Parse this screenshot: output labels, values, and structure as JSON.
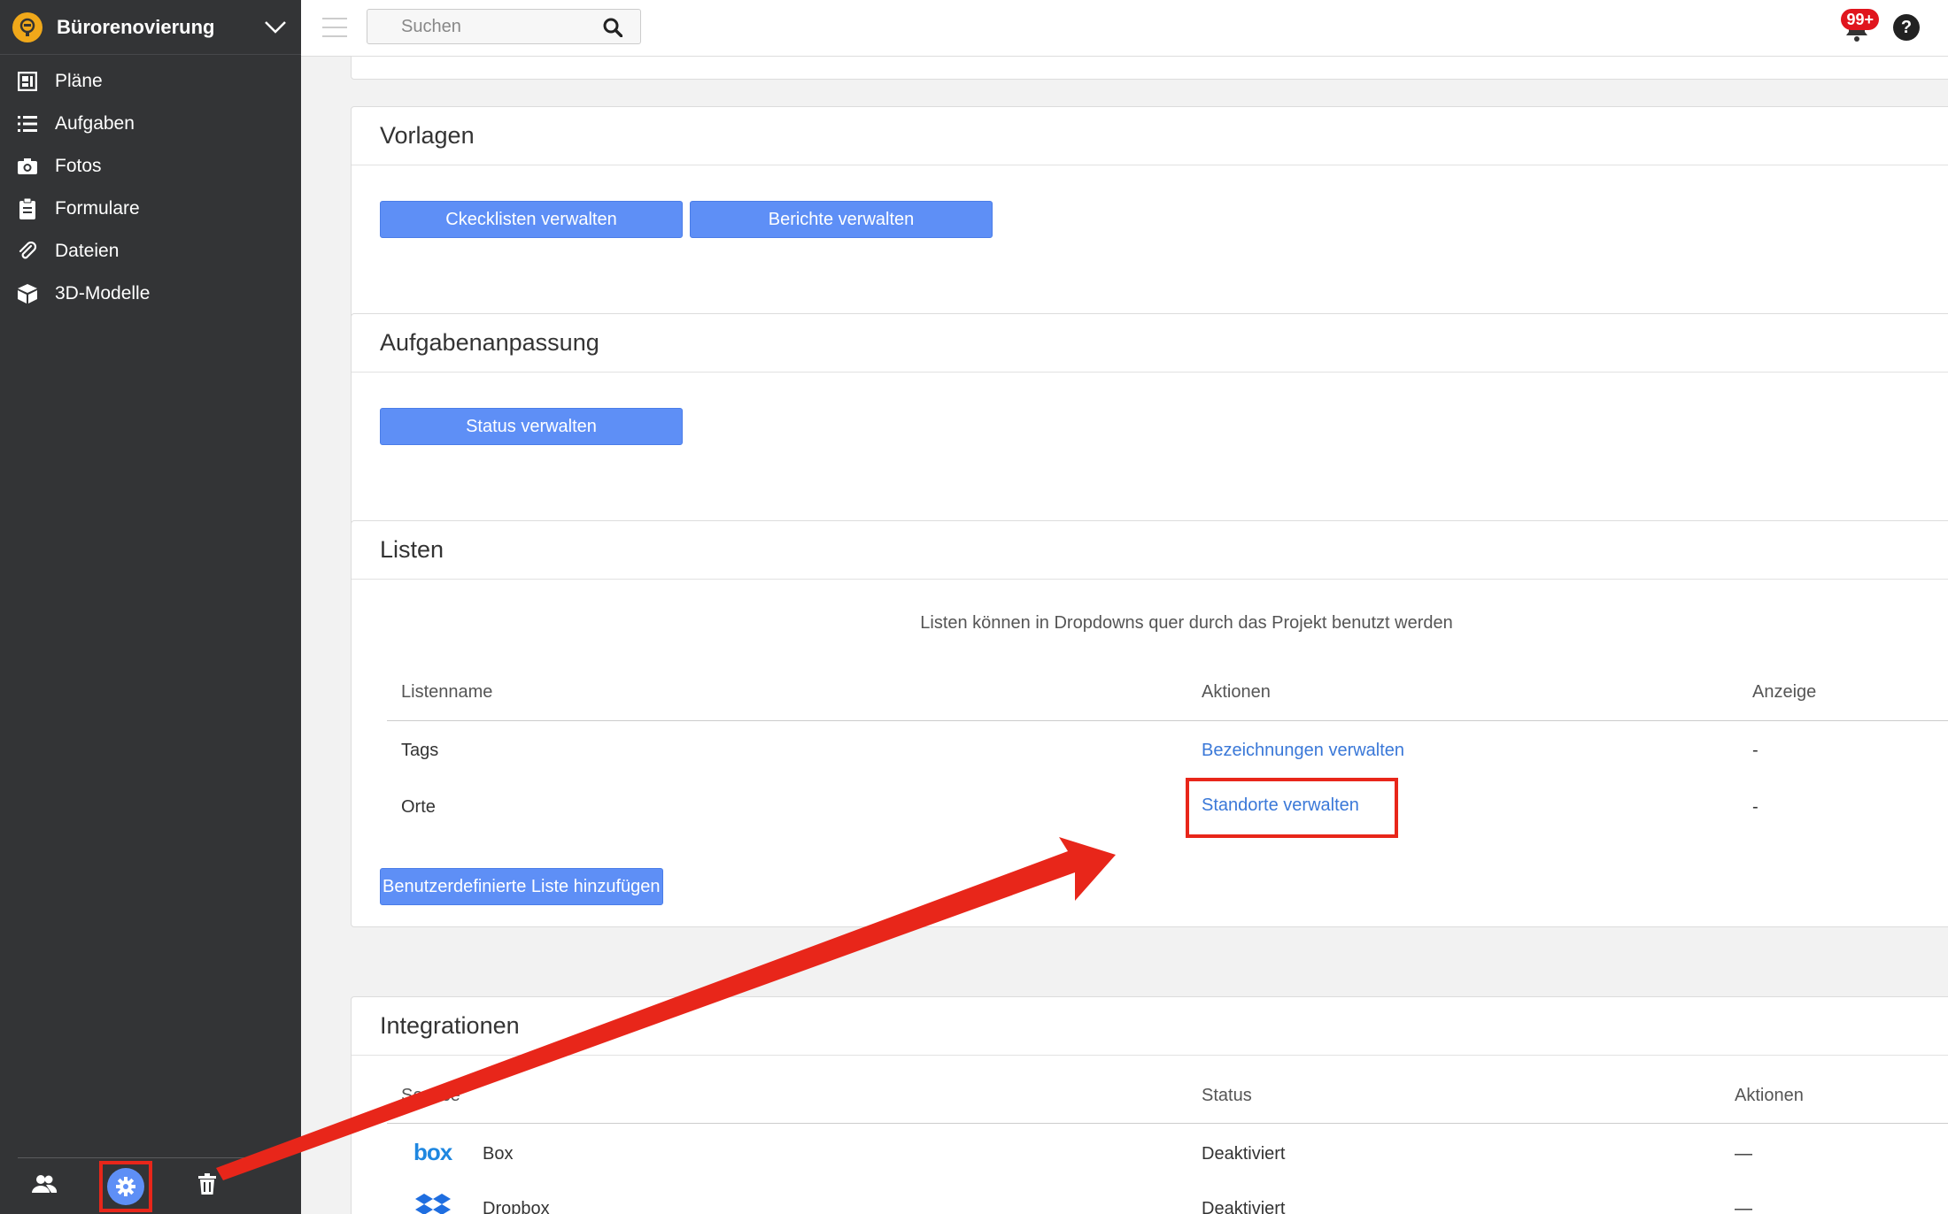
{
  "sidebar": {
    "project_title": "Bürorenovierung",
    "items": [
      {
        "label": "Pläne",
        "icon": "plans-icon"
      },
      {
        "label": "Aufgaben",
        "icon": "list-icon"
      },
      {
        "label": "Fotos",
        "icon": "camera-icon"
      },
      {
        "label": "Formulare",
        "icon": "clipboard-icon"
      },
      {
        "label": "Dateien",
        "icon": "paperclip-icon"
      },
      {
        "label": "3D-Modelle",
        "icon": "cube-icon"
      }
    ],
    "footer": [
      "users-icon",
      "gear-icon",
      "trash-icon"
    ]
  },
  "topbar": {
    "search_placeholder": "Suchen",
    "notification_badge": "99+",
    "help_label": "?"
  },
  "sections": {
    "vorlagen": {
      "title": "Vorlagen",
      "buttons": [
        "Ckecklisten verwalten",
        "Berichte verwalten"
      ]
    },
    "aufgabenanpassung": {
      "title": "Aufgabenanpassung",
      "button": "Status verwalten"
    },
    "listen": {
      "title": "Listen",
      "description": "Listen können in Dropdowns quer durch das Projekt benutzt werden",
      "columns": [
        "Listenname",
        "Aktionen",
        "Anzeige"
      ],
      "rows": [
        {
          "name": "Tags",
          "action": "Bezeichnungen verwalten",
          "display": "-"
        },
        {
          "name": "Orte",
          "action": "Standorte verwalten",
          "display": "-"
        }
      ],
      "add_button": "Benutzerdefinierte Liste hinzufügen"
    },
    "integrationen": {
      "title": "Integrationen",
      "columns": [
        "Service",
        "Status",
        "Aktionen"
      ],
      "rows": [
        {
          "logo": "box",
          "service": "Box",
          "status": "Deaktiviert",
          "action": "—"
        },
        {
          "logo": "dropbox-icon",
          "service": "Dropbox",
          "status": "Deaktiviert",
          "action": "—"
        }
      ]
    }
  },
  "colors": {
    "sidebar_bg": "#333436",
    "accent": "#5e8ff6",
    "link": "#3a78d8",
    "annotation": "#e8261a"
  }
}
